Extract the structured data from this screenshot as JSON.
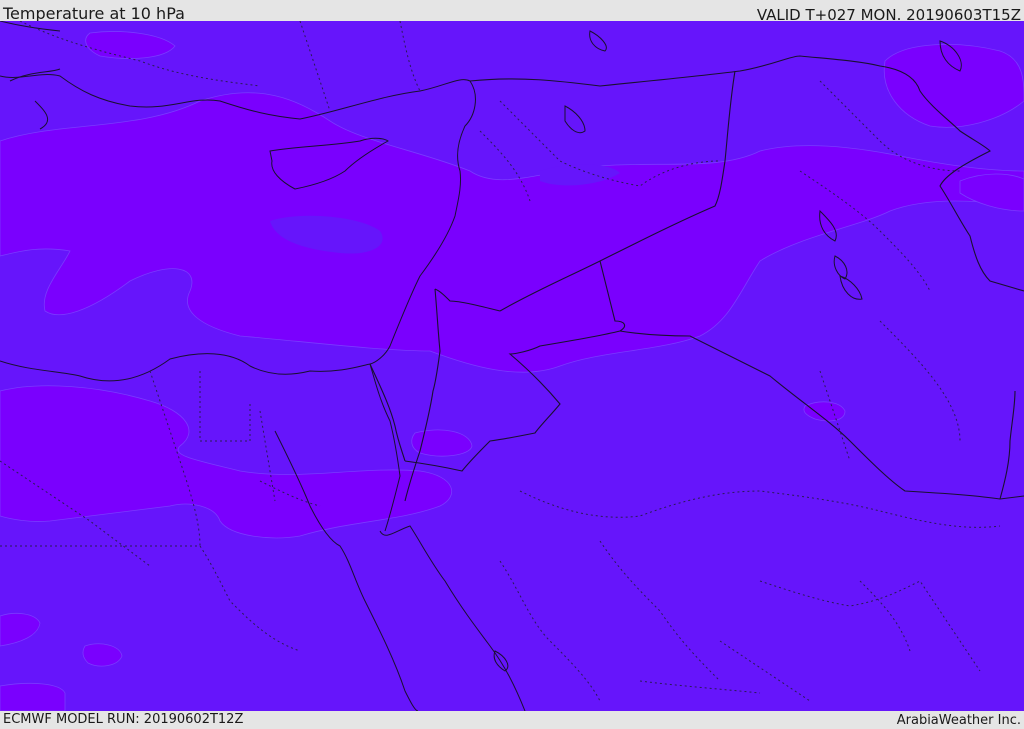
{
  "header": {
    "title": "Temperature at 10 hPa",
    "valid": "VALID T+027 MON. 20190603T15Z"
  },
  "footer": {
    "model_run": "ECMWF MODEL RUN: 20190602T12Z",
    "credit": "ArabiaWeather Inc."
  },
  "map": {
    "colors": {
      "base": "#6615fb",
      "warmer_band": "#7a00fe",
      "coastline": "#1a1030"
    }
  }
}
